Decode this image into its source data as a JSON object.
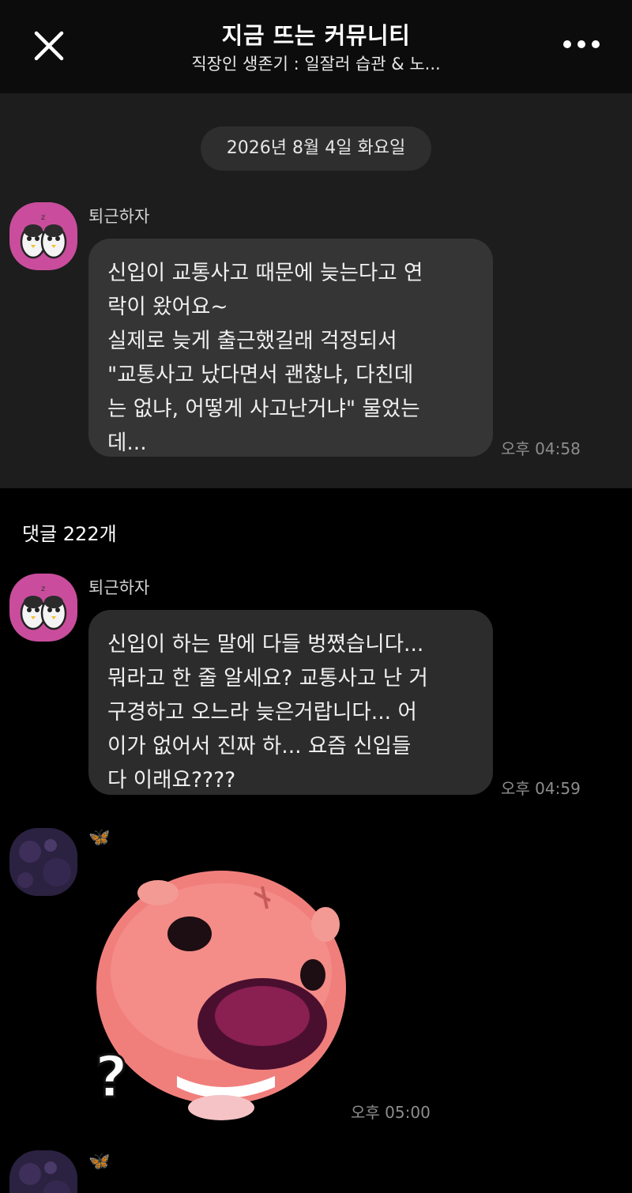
{
  "header": {
    "title": "지금 뜨는 커뮤니티",
    "subtitle": "직장인 생존기 : 일잘러 습관 & 노...",
    "close_icon": "close-icon",
    "more_icon": "more-horizontal-icon"
  },
  "post": {
    "date": "2026년 8월 4일 화요일",
    "author": "퇴근하자",
    "message": "신입이 교통사고 때문에 늦는다고 연\n락이 왔어요~\n실제로 늦게 출근했길래 걱정되서\n\"교통사고 났다면서 괜찮냐, 다친데\n는 없냐, 어떻게 사고난거냐\" 물었는\n데...",
    "time": "오후 04:58"
  },
  "comments": {
    "count_label": "댓글 222개",
    "items": [
      {
        "author": "퇴근하자",
        "message": "신입이 하는 말에 다들 벙쪘습니다...\n뭐라고 한 줄 알세요? 교통사고 난 거\n구경하고 오느라 늦은거랍니다... 어\n이가 없어서 진짜 하... 요즘 신입들\n다 이래요????",
        "time": "오후 04:59"
      },
      {
        "author_icon": "butterfly-icon",
        "author_glyph": "🦋",
        "sticker": "confused-pink-character-sticker",
        "time": "오후 05:00"
      },
      {
        "author_icon": "butterfly-icon",
        "author_glyph": "🦋"
      }
    ]
  },
  "colors": {
    "header_bg": "#0c0c0c",
    "post_bg": "#1d1d1d",
    "comments_bg": "#000000",
    "bubble_post": "#353535",
    "bubble_comment": "#2c2c2c",
    "avatar_pink": "#c94d9c",
    "sticker_pink": "#f07f7c"
  }
}
